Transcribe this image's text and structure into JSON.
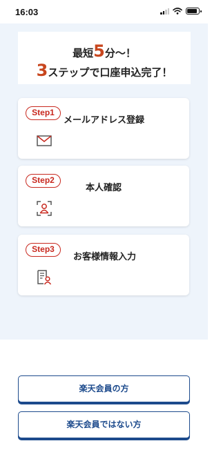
{
  "status_bar": {
    "time": "16:03"
  },
  "hero": {
    "line1_prefix": "最短",
    "line1_number": "5",
    "line1_suffix": "分〜！",
    "line2_number": "3",
    "line2_suffix": "ステップで口座申込完了！",
    "accent_color": "#c8461e"
  },
  "steps": [
    {
      "badge": "Step1",
      "title": "メールアドレス登録",
      "icon": "mail-icon"
    },
    {
      "badge": "Step2",
      "title": "本人確認",
      "icon": "person-scan-icon"
    },
    {
      "badge": "Step3",
      "title": "お客様情報入力",
      "icon": "document-person-icon"
    }
  ],
  "buttons": {
    "member": "楽天会員の方",
    "non_member": "楽天会員ではない方",
    "color": "#1c4a8c"
  }
}
